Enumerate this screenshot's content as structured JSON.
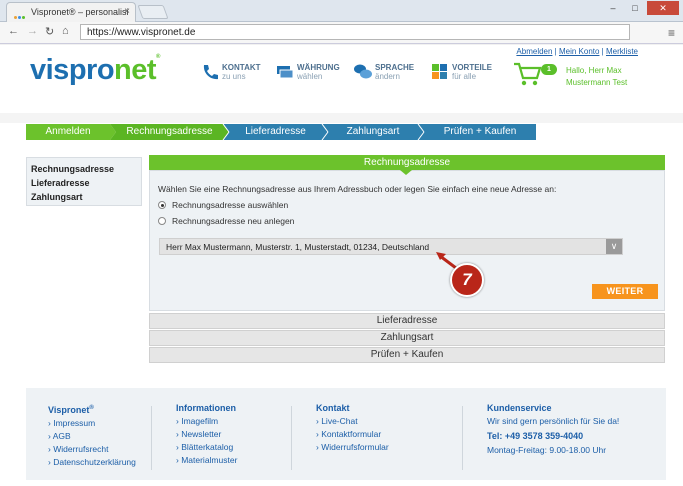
{
  "browser": {
    "tab_title": "Vispronet® – personalisi",
    "tab_close": "×",
    "url": "https://www.vispronet.de",
    "window_buttons": [
      "–",
      "□",
      "✕"
    ]
  },
  "header": {
    "logo_part1": "vispro",
    "logo_part2": "net",
    "logo_sup": "®",
    "top_links": [
      "Abmelden",
      "Mein Konto",
      "Merkliste"
    ],
    "top_links_sep": " | ",
    "items": [
      {
        "title": "KONTAKT",
        "subtitle": "zu uns"
      },
      {
        "title": "WÄHRUNG",
        "subtitle": "wählen"
      },
      {
        "title": "SPRACHE",
        "subtitle": "ändern"
      },
      {
        "title": "VORTEILE",
        "subtitle": "für alle"
      }
    ],
    "cart_count": "1",
    "greeting_line1": "Hallo, Herr Max",
    "greeting_line2": "Mustermann Test",
    "colors": {
      "blue": "#1d6fb0",
      "green": "#5bbf2a"
    }
  },
  "steps": [
    {
      "label": "Anmelden",
      "state": "done"
    },
    {
      "label": "Rechnungsadresse",
      "state": "active"
    },
    {
      "label": "Lieferadresse",
      "state": "pending"
    },
    {
      "label": "Zahlungsart",
      "state": "pending"
    },
    {
      "label": "Prüfen + Kaufen",
      "state": "pending"
    }
  ],
  "left_nav": [
    "Rechnungsadresse",
    "Lieferadresse",
    "Zahlungsart"
  ],
  "main": {
    "section_title": "Rechnungsadresse",
    "intro": "Wählen Sie eine Rechnungsadresse aus Ihrem Adressbuch oder legen Sie einfach eine neue Adresse an:",
    "options": [
      {
        "label": "Rechnungsadresse auswählen",
        "selected": true
      },
      {
        "label": "Rechnungsadresse neu anlegen",
        "selected": false
      }
    ],
    "address_select": "Herr Max Mustermann, Musterstr. 1, Musterstadt, 01234, Deutschland",
    "continue_button": "WEITER",
    "annotation_number": "7",
    "collapsed_sections": [
      "Lieferadresse",
      "Zahlungsart",
      "Prüfen + Kaufen"
    ]
  },
  "footer": {
    "col1": {
      "title": "Vispronet",
      "sup": "®",
      "links": [
        "Impressum",
        "AGB",
        "Widerrufsrecht",
        "Datenschutzerklärung"
      ]
    },
    "col2": {
      "title": "Informationen",
      "links": [
        "Imagefilm",
        "Newsletter",
        "Blätterkatalog",
        "Materialmuster"
      ]
    },
    "col3": {
      "title": "Kontakt",
      "links": [
        "Live-Chat",
        "Kontaktformular",
        "Widerrufsformular"
      ]
    },
    "col4": {
      "title": "Kundenservice",
      "line1": "Wir sind gern persönlich für Sie da!",
      "phone": "Tel: +49 3578 359-4040",
      "hours": "Montag-Freitag: 9.00-18.00 Uhr"
    },
    "link_prefix": "› "
  }
}
